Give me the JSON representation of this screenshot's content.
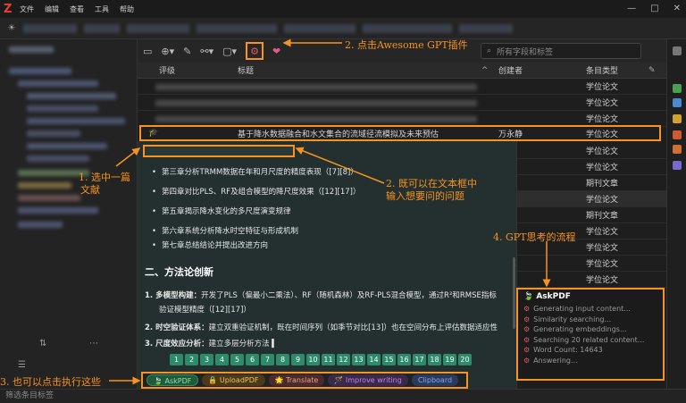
{
  "menu": {
    "logo": "Z",
    "items": [
      "文件",
      "编辑",
      "查看",
      "工具",
      "帮助"
    ]
  },
  "window_controls": [
    "—",
    "□",
    "✕"
  ],
  "search": {
    "placeholder": "所有字段和标签"
  },
  "table": {
    "headers": {
      "rating": "评级",
      "title": "标题",
      "creator": "创建者",
      "item_type": "条目类型"
    },
    "selected_row": {
      "title": "基于降水数据融合和水文集合的流域径流模拟及未来预估",
      "creator": "万永静",
      "item_type": "学位论文"
    },
    "visible_rows": [
      {
        "creator": "",
        "item_type": "学位论文"
      },
      {
        "creator": "",
        "item_type": "学位论文"
      },
      {
        "creator": "",
        "item_type": "学位论文"
      },
      {
        "creator": "",
        "item_type": "学位论文"
      },
      {
        "creator": "",
        "item_type": "学位论文"
      },
      {
        "creator": "",
        "item_type": "学位论文"
      },
      {
        "creator": "",
        "item_type": "学位论文"
      },
      {
        "creator": "",
        "item_type": "学位论文"
      },
      {
        "creator": "",
        "item_type": "期刊文章"
      },
      {
        "creator": "",
        "item_type": "学位论文"
      },
      {
        "creator": "",
        "item_type": "期刊文章"
      },
      {
        "creator": "",
        "item_type": "学位论文"
      },
      {
        "creator": "",
        "item_type": "学位论文"
      }
    ]
  },
  "popup": {
    "bullets": [
      "第三章分析TRMM数据在年和月尺度的精度表现（[7][8]）",
      "第四章对比PLS、RF及组合模型的降尺度效果（[12][17]）",
      "第五章揭示降水变化的多尺度演变规律",
      "第六章系统分析降水时空特征与形成机制",
      "第七章总结结论并提出改进方向"
    ],
    "section_title": "二、方法论创新",
    "numbered": [
      {
        "label": "1. 多模型构建：",
        "text": "开发了PLS（偏最小二乘法）、RF（随机森林）及RF-PLS混合模型，通过R²和RMSE指标"
      },
      {
        "label": "",
        "text": "验证模型精度（[12][17]）"
      },
      {
        "label": "2. 时空验证体系：",
        "text": "建立双重验证机制，既在时间序列（如季节对比[13]）也在空间分布上评估数据适应性"
      },
      {
        "label": "3. 尺度效应分析：",
        "text": "建立多层分析方法 ▍"
      }
    ],
    "pages": [
      "1",
      "2",
      "3",
      "4",
      "5",
      "6",
      "7",
      "8",
      "9",
      "10",
      "11",
      "12",
      "13",
      "14",
      "15",
      "16",
      "17",
      "18",
      "19",
      "20"
    ]
  },
  "actions": [
    "🍃 AskPDF",
    "🔒 UploadPDF",
    "🌟 Translate",
    "🪄 Improve writing",
    "Clipboard"
  ],
  "gpt_panel": {
    "title": "🍃 AskPDF",
    "steps": [
      "Generating input content...",
      "Similarity searching...",
      "Generating embeddings...",
      "Searching 20 related content...",
      "Word Count: 14643",
      "Answering..."
    ]
  },
  "status": "筛选条目标签",
  "annotations": {
    "a1": "1. 选中一篇",
    "a1b": "文献",
    "a2": "2. 点击Awesome GPT插件",
    "a3": "2. 既可以在文本框中",
    "a3b": "输入想要问的问题",
    "a4": "4. GPT思考的流程",
    "a5": "3. 也可以点击执行这些"
  },
  "colors": {
    "annotation": "#f7931e",
    "page_btn": "#2d8a6a"
  }
}
